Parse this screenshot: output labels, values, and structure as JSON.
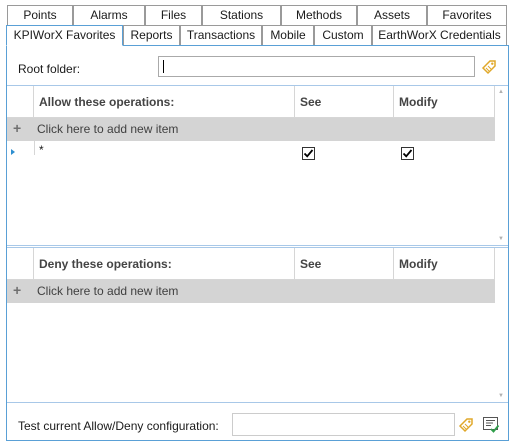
{
  "tabs_top": [
    {
      "label": "Points"
    },
    {
      "label": "Alarms"
    },
    {
      "label": "Files"
    },
    {
      "label": "Stations"
    },
    {
      "label": "Methods"
    },
    {
      "label": "Assets"
    },
    {
      "label": "Favorites"
    }
  ],
  "tabs_second": [
    {
      "label": "KPIWorX Favorites",
      "active": true
    },
    {
      "label": "Reports"
    },
    {
      "label": "Transactions"
    },
    {
      "label": "Mobile"
    },
    {
      "label": "Custom"
    },
    {
      "label": "EarthWorX Credentials"
    }
  ],
  "root_folder": {
    "label": "Root folder:",
    "value": ""
  },
  "allow_grid": {
    "headers": {
      "operations": "Allow these operations:",
      "see": "See",
      "modify": "Modify"
    },
    "add_label": "Click here to add new item",
    "rows": [
      {
        "operation": "*",
        "see": true,
        "modify": true
      }
    ]
  },
  "deny_grid": {
    "headers": {
      "operations": "Deny these operations:",
      "see": "See",
      "modify": "Modify"
    },
    "add_label": "Click here to add new item",
    "rows": []
  },
  "test": {
    "label": "Test current Allow/Deny configuration:",
    "value": ""
  },
  "icons": {
    "add": "+",
    "root_browse": "tag-icon",
    "test_browse": "tag-icon",
    "test_run": "checklist-icon",
    "row_pointer": "row-indicator-icon",
    "checkbox_checked": "checkmark-icon"
  },
  "colors": {
    "accent": "#5aa0d6",
    "add_row_bg": "#d4d4d4",
    "icon_gold": "#e0a82a"
  }
}
